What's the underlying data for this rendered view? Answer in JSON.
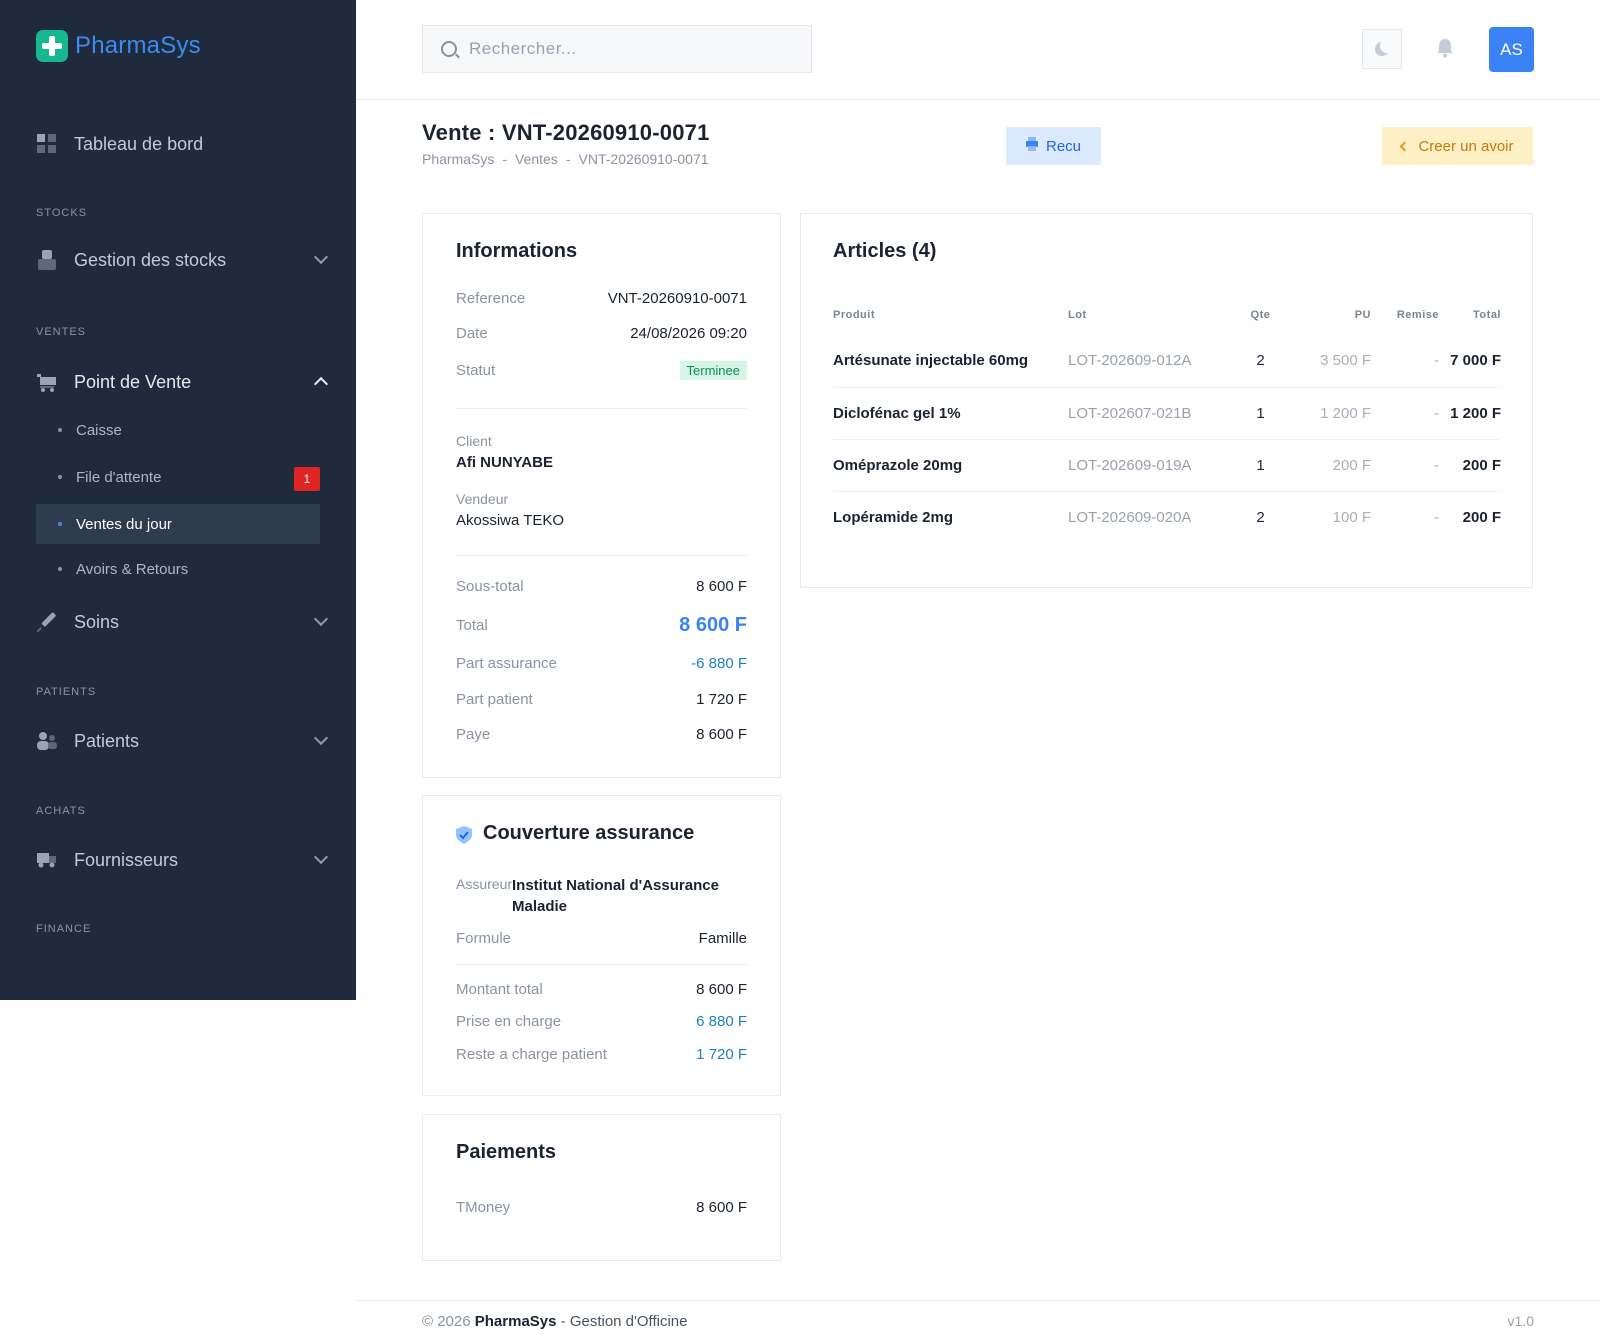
{
  "app": {
    "name": "PharmaSys"
  },
  "search": {
    "placeholder": "Rechercher..."
  },
  "user": {
    "initials": "AS"
  },
  "sidebar": {
    "dashboard": "Tableau de bord",
    "sections": {
      "stocks": "STOCKS",
      "ventes": "VENTES",
      "patients": "PATIENTS",
      "achats": "ACHATS",
      "finance": "FINANCE"
    },
    "stock_mgmt": "Gestion des stocks",
    "pos": "Point de Vente",
    "pos_sub": [
      "Caisse",
      "File d'attente",
      "Ventes du jour",
      "Avoirs & Retours"
    ],
    "queue_badge": "1",
    "soins": "Soins",
    "patients": "Patients",
    "fournisseurs": "Fournisseurs"
  },
  "header": {
    "title": "Vente : VNT-20260910-0071",
    "breadcrumb": [
      "PharmaSys",
      "-",
      "Ventes",
      "-",
      "VNT-20260910-0071"
    ],
    "recu_label": "Recu",
    "avoir_label": "Creer un avoir"
  },
  "info": {
    "title": "Informations",
    "reference_label": "Reference",
    "reference": "VNT-20260910-0071",
    "date_label": "Date",
    "date": "24/08/2026 09:20",
    "statut_label": "Statut",
    "statut": "Terminee",
    "client_label": "Client",
    "client": "Afi NUNYABE",
    "vendeur_label": "Vendeur",
    "vendeur": "Akossiwa TEKO",
    "soustotal_label": "Sous-total",
    "soustotal": "8 600 F",
    "total_label": "Total",
    "total": "8 600 F",
    "assurance_label": "Part assurance",
    "assurance": "-6 880 F",
    "patient_label": "Part patient",
    "patient": "1 720 F",
    "paye_label": "Paye",
    "paye": "8 600 F"
  },
  "coverage": {
    "title": "Couverture assurance",
    "assureur_label": "Assureur",
    "assureur": "Institut National d'Assurance Maladie",
    "formule_label": "Formule",
    "formule": "Famille",
    "montant_label": "Montant total",
    "montant": "8 600 F",
    "prise_label": "Prise en charge",
    "prise": "6 880 F",
    "reste_label": "Reste a charge patient",
    "reste": "1 720 F"
  },
  "payments": {
    "title": "Paiements",
    "method": "TMoney",
    "amount": "8 600 F"
  },
  "articles": {
    "title": "Articles (4)",
    "headers": [
      "Produit",
      "Lot",
      "Qte",
      "PU",
      "Remise",
      "Total"
    ],
    "rows": [
      {
        "produit": "Artésunate injectable 60mg",
        "lot": "LOT-202609-012A",
        "qte": "2",
        "pu": "3 500 F",
        "remise": "-",
        "total": "7 000 F"
      },
      {
        "produit": "Diclofénac gel 1%",
        "lot": "LOT-202607-021B",
        "qte": "1",
        "pu": "1 200 F",
        "remise": "-",
        "total": "1 200 F"
      },
      {
        "produit": "Oméprazole 20mg",
        "lot": "LOT-202609-019A",
        "qte": "1",
        "pu": "200 F",
        "remise": "-",
        "total": "200 F"
      },
      {
        "produit": "Lopéramide 2mg",
        "lot": "LOT-202609-020A",
        "qte": "2",
        "pu": "100 F",
        "remise": "-",
        "total": "200 F"
      }
    ]
  },
  "footer": {
    "copyright": "© 2026",
    "brand": "PharmaSys",
    "desc": "- Gestion d'Officine",
    "version": "v1.0"
  }
}
